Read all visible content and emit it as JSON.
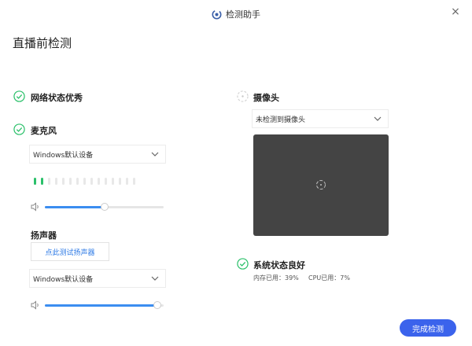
{
  "window": {
    "title": "检测助手",
    "close_label": "×"
  },
  "page": {
    "title": "直播前检测"
  },
  "network": {
    "label": "网络状态优秀"
  },
  "microphone": {
    "label": "麦克风",
    "device": "Windows默认设备",
    "level_bars_active": 2,
    "level_bars_total": 15,
    "volume": 0.5
  },
  "speaker": {
    "label": "扬声器",
    "test_button": "点此测试扬声器",
    "device": "Windows默认设备",
    "volume": 0.95
  },
  "camera": {
    "label": "摄像头",
    "device": "未检测到摄像头"
  },
  "system": {
    "label": "系统状态良好",
    "memory": "内存已用：39%",
    "cpu": "CPU已用：7%"
  },
  "actions": {
    "finish": "完成检测"
  },
  "colors": {
    "accent": "#3b8df0",
    "ok": "#2bc06a",
    "primary_button": "#3b63ec",
    "preview_bg": "#444444"
  }
}
